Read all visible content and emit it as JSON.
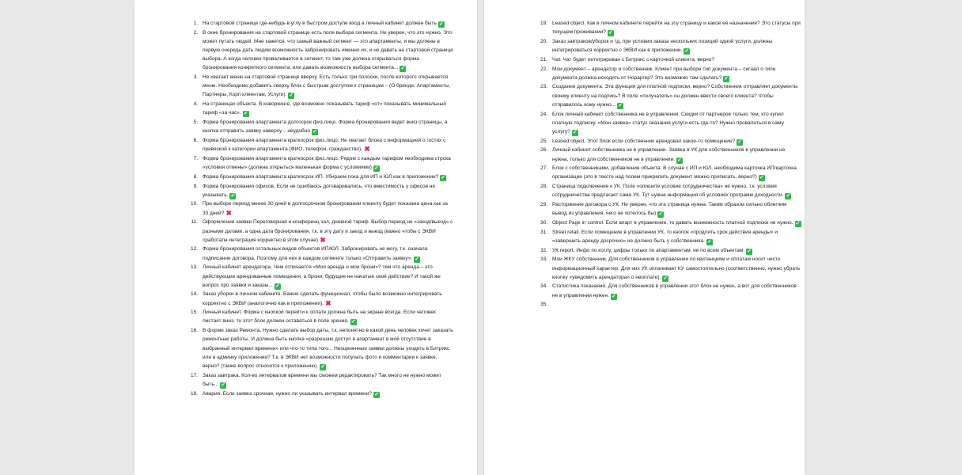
{
  "colors": {
    "background": "#e9e9e9",
    "page": "#ffffff",
    "check": "#2fb84d",
    "cross": "#e0245e",
    "text": "#222222"
  },
  "icons": {
    "check": "green-check-mark-icon",
    "cross": "red-cross-mark-icon"
  },
  "pages": [
    {
      "items": [
        {
          "n": "1.",
          "text": "На стартовой странице где-нибудь в углу в быстром доступе вход в личный кабинет должен быть",
          "mark": "check"
        },
        {
          "n": "2.",
          "text": "В окне бронирования на стартовой странице есть поле выбора сегмента. Не уверен, что это нужно. Это может путать людей. Мне кажется, что самый важный сегмент — это апартаменты, и мы должны в первую очередь дать людям возможность забронировать именно их, и не давать на стартовой странице выбора. А когда человек проваливается в сегмент, то там уже должна открываться форма бронирования конкретного сегмента, или давать возможность выбора сегмента...",
          "mark": "check"
        },
        {
          "n": "3.",
          "text": "Не хватает меню на стартовой странице вверху. Есть только три полоски, после которого открывается меню. Необходимо добавить сверху блок с быстрым доступом к страницам – (О бренде, Апартаменты, Партнеры, Корп клиентам, Услуги).",
          "mark": "check"
        },
        {
          "n": "4.",
          "text": "На страницах объекта. В коворкинге, где возможно показывать тариф «от» показывать минимальный тариф «за час».",
          "mark": "check"
        },
        {
          "n": "5.",
          "text": "Форма бронирования апартамента долгосрок физ.лицо. Форма бронирования ведет вниз страницы, а кнопка отправить заявку наверху – неудобно",
          "mark": "check"
        },
        {
          "n": "6.",
          "text": "Форма бронирования апартамента краткосрок физ.лицо. Не хватает блока с информацией о гостях с привязкой к категории апартамента (ФИО, телефон, гражданство).",
          "mark": "cross"
        },
        {
          "n": "7.",
          "text": "Форма бронирования апартамента краткосрок физ.лицо. Рядом с каждым тарифом необходима строка «условия отмены» (должна открыться маленькая форма с условиями)",
          "mark": "check"
        },
        {
          "n": "8.",
          "text": "Форма бронирования апартамента краткосрок ИП. Убираем пока для ИП и ЮЛ как в приложении?",
          "mark": "check"
        },
        {
          "n": "9.",
          "text": "Форма бронирования офисов. Если не ошибаюсь договаривались, что вместимость у офисов не указывать.",
          "mark": "check"
        },
        {
          "n": "10.",
          "text": "При выборе период менее 30 дней в долгосрочном бронировании клиенту будет показана цена как за 30 дней?",
          "mark": "cross"
        },
        {
          "n": "11.",
          "text": "Оформление заявки Переговорная и конференц зал, дневной тариф. Выбор период не «заезд/выезд» с разными датами, а одна дата бронирования, т.к. в эту дату и заезд и выезд (важно чтобы с ЭКВИ сработала интеграция корректно в этом случае)",
          "mark": "cross"
        },
        {
          "n": "12.",
          "text": "Форма бронирования остальных видов объектов ИП/ЮЛ. Забронировать не могу, т.к. сначала подписание договора. Поэтому для них в каждом сегменте только «Отправить заявку».",
          "mark": "check"
        },
        {
          "n": "13.",
          "text": "Личный кабинет арендатора. Чем отличается «Моя аренда и мои брони»? тем что аренда – это действующие арендованные помещения, а брони, будущие не начатые своё действие? И такой же вопрос про заявки и заказы...",
          "mark": "check"
        },
        {
          "n": "14.",
          "text": "Заказ уборки в личном кабинете. Важно сделать функционал, чтобы было возможно интегрировать корректно с ЭКВИ (аналогично как в приложении).",
          "mark": "cross"
        },
        {
          "n": "15.",
          "text": "Личный кабинет. Форма с кнопкой перейти к оплате должна быть на экране всегда. Если человек листает вниз, то этот блок должен оставаться в поле зрения.",
          "mark": "check"
        },
        {
          "n": "16.",
          "text": "В форме заказ Ремонта. Нужно сделать выбор даты, т.к. непонятно в какой день человек хочет заказать ремонтные работы. И должна быть кнопка «разрешаю доступ в апартамент в моё отсутствие в выбранный интервал времени» или что-то типа того... Неоцененные заявки должны уходить в Битрикс или в админку приложения? Т.к. в ЭКВИ нет возможности получать фото и комментарии к заявке, верно? (также вопрос относится к приложению).",
          "mark": "check"
        },
        {
          "n": "17.",
          "text": "Заказ завтрака. Кол-во интервалов времени мы сможем редактировать? Так много не нужно может быть...",
          "mark": "check"
        },
        {
          "n": "18.",
          "text": "Авария. Если заявка срочная, нужно ли указывать интервал времени?",
          "mark": "check"
        }
      ]
    },
    {
      "items": [
        {
          "n": "19.",
          "text": "Leased object. Как в личном кабинете перейти на эту страницу и какое её назначение? Это статусы при текущем проживании?",
          "mark": "check"
        },
        {
          "n": "20.",
          "text": "Заказ завтраков/уборок и тд, при условии заказа нескольких позиций одной услуги, должны интегрироваться корректно с ЭКВИ как в приложении.",
          "mark": "check"
        },
        {
          "n": "21.",
          "text": "Чат. Чат будет интегрирован с Битрикс с карточкой клиента, верно?",
          "mark": "none"
        },
        {
          "n": "22.",
          "text": "Мои документ – арендатор и собственник. Клиент при выборе тип документа – сигнал о типе документа должна исходить от Нораргер? Это возможно там сделать?",
          "mark": "check"
        },
        {
          "n": "23.",
          "text": "Создание документа. Эта функция для платной подписки, верно? Собственник отправляет документы своему клиенту на подпись? В поле «получатель» он должен ввести своего клиента? Чтобы отправилось кому нужно...",
          "mark": "check"
        },
        {
          "n": "24.",
          "text": "Блок личный кабинет собственника не в управлении. Скидки от партнеров только тем, кто купил платную подписку. «Мои заявка» статус оказания услуги есть где-то? Нужно провалиться в саму услугу?",
          "mark": "check"
        },
        {
          "n": "25.",
          "text": "Leased object. Этот блок если собственник арендовал какое-то помещение?",
          "mark": "check"
        },
        {
          "n": "26.",
          "text": "Личный кабинет собственника не в управлении. Заявка в УК для собственников в управлении не нужна, только для собственников не в управлении.",
          "mark": "check"
        },
        {
          "n": "27.",
          "text": "Блок с собственниками, добавление объекта. В случае с ИП и ЮЛ, необходима карточка ИП/карточка организации (это в тексте над полем прикрепить документ можно прописать, верно?)",
          "mark": "check"
        },
        {
          "n": "28.",
          "text": "Страница подключение к УК. Поле «опишите условие сотрудничества» не нужно, т.к. условия сотрудничества предлагает сама УК. Тут нужна информация об условиях программ доходности.",
          "mark": "check"
        },
        {
          "n": "29.",
          "text": "Расторжение договора с УК. Не уверен, что эта страница нужна. Таким образом сильно облегчим вывод из управления, чего не хотелось бы)",
          "mark": "check"
        },
        {
          "n": "30.",
          "text": "Object Page in control. Если апарт в управлении, то давать возможность платной подписки не нужно.",
          "mark": "check"
        },
        {
          "n": "31.",
          "text": "Street retail. Если помещение в управлении УК, то кнопок «продлить срок действия аренды» и «завершить аренду досрочно» не должно быть у собственника.",
          "mark": "check"
        },
        {
          "n": "32.",
          "text": "УК report. Инфо по котлу, цифры только по апартаментам, не по всем объектам.",
          "mark": "check"
        },
        {
          "n": "33.",
          "text": "Мои ЖКУ собственник. Для собственников в управлении по квитанциям и оплатам носит чисто информационный характер. Для них УК оплачивает КУ самостоятельно (соответственно, нужно убрать кнопку «уведомить арендатора» о неоплате).",
          "mark": "check"
        },
        {
          "n": "34.",
          "text": "Статистика показаний. Для собственников в управлении этот блок не нужен, а вот для собственников не в управлении нужен.",
          "mark": "check"
        },
        {
          "n": "35.",
          "text": "",
          "mark": "none"
        }
      ]
    }
  ]
}
